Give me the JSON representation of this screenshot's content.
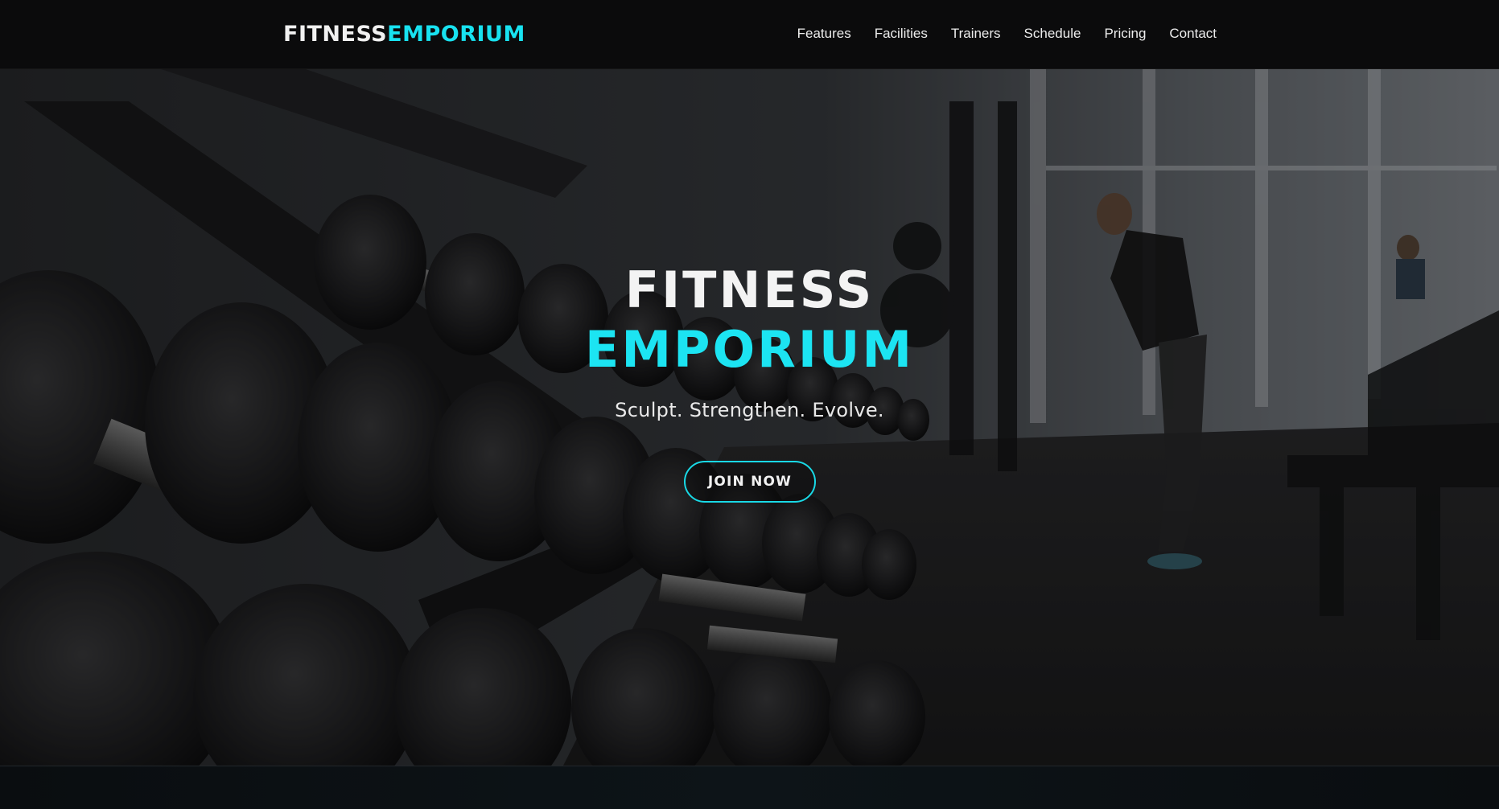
{
  "brand": {
    "logo_white": "FITNESS",
    "logo_cyan": "EMPORIUM"
  },
  "nav": {
    "items": [
      {
        "label": "Features"
      },
      {
        "label": "Facilities"
      },
      {
        "label": "Trainers"
      },
      {
        "label": "Schedule"
      },
      {
        "label": "Pricing"
      },
      {
        "label": "Contact"
      }
    ]
  },
  "hero": {
    "title_line1": "FITNESS",
    "title_line2": "EMPORIUM",
    "tagline": "Sculpt. Strengthen. Evolve.",
    "cta_label": "JOIN NOW"
  },
  "colors": {
    "accent": "#18e2f0",
    "nav_background": "#0b0b0c",
    "text": "#f1f1f1"
  },
  "icons": [
    "dumbbell-rack-image",
    "gym-background-image"
  ]
}
